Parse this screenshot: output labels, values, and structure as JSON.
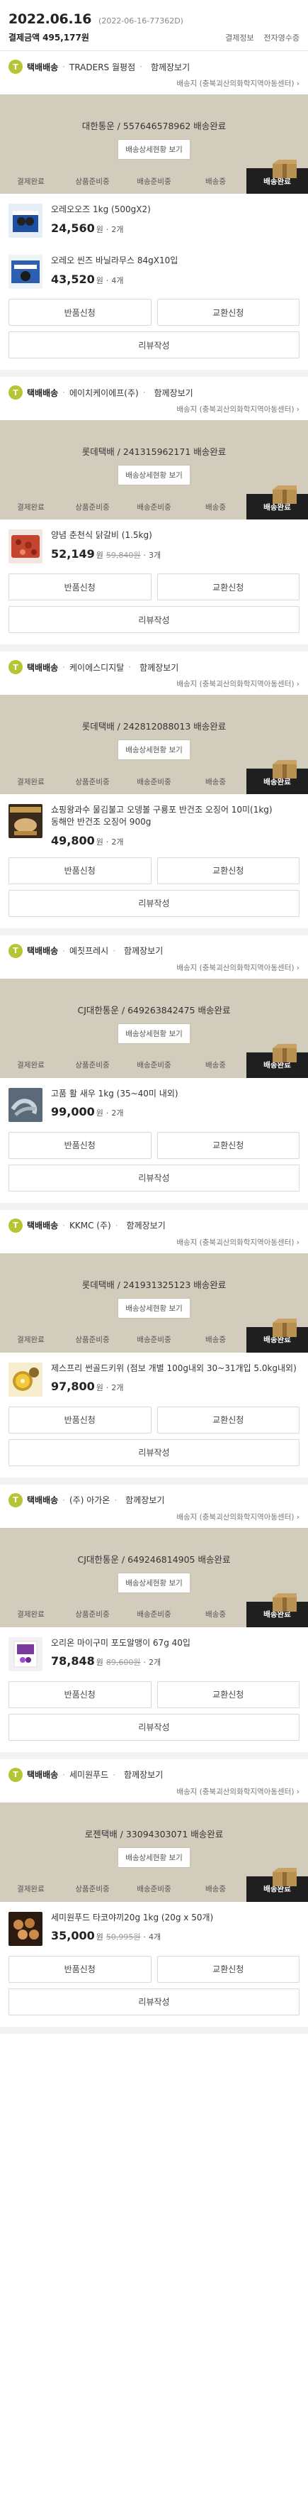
{
  "order": {
    "date": "2022.06.16",
    "number": "(2022-06-16-77362D)",
    "amount_label": "결제금액",
    "amount": "495,177원",
    "link_receipt": "결제정보",
    "link_doc": "전자영수증"
  },
  "labels": {
    "track": "배송상세현황 보기",
    "steps": [
      "결제완료",
      "상품준비중",
      "배송준비중",
      "배송중",
      "배송완료"
    ],
    "return": "반품신청",
    "exchange": "교환신청",
    "review": "리뷰작성",
    "unit": "원",
    "bundle": "함께장보기",
    "addr_prefix": "배송지"
  },
  "packages": [
    {
      "type": "택배배송",
      "seller": "TRADERS 월평점",
      "address": "(충북괴산의화학지역아동센터)",
      "carrier_status": "대한통운 / 557646578962 배송완료",
      "items": [
        {
          "name": "오레오오즈 1kg (500gX2)",
          "price": "24,560",
          "orig": "",
          "qty": "2개",
          "thumb": "oreo"
        },
        {
          "name": "오레오 씬즈 바닐라무스 84gX10입",
          "price": "43,520",
          "orig": "",
          "qty": "4개",
          "thumb": "oreo2"
        }
      ]
    },
    {
      "type": "택배배송",
      "seller": "에이치케이에프(주)",
      "address": "(충북괴산의화학지역아동센터)",
      "carrier_status": "롯데택배 / 241315962171 배송완료",
      "items": [
        {
          "name": "양념 춘천식 닭갈비 (1.5kg)",
          "price": "52,149",
          "orig": "59,840원",
          "qty": "3개",
          "thumb": "chicken"
        }
      ]
    },
    {
      "type": "택배배송",
      "seller": "케이에스디지탈",
      "address": "(충북괴산의화학지역아동센터)",
      "carrier_status": "롯데택배 / 242812088013 배송완료",
      "items": [
        {
          "name": "쇼핑왕과수 물김불고 오뎅볼 구룡포 반건조 오징어 10미(1kg)\n동해안 반건조 오징어 900g",
          "price": "49,800",
          "orig": "",
          "qty": "2개",
          "thumb": "squid"
        }
      ]
    },
    {
      "type": "택배배송",
      "seller": "예칫프레시",
      "address": "(충북괴산의화학지역아동센터)",
      "carrier_status": "CJ대한통운 / 649263842475 배송완료",
      "items": [
        {
          "name": "고품 활 새우 1kg (35~40미 내외)",
          "price": "99,000",
          "orig": "",
          "qty": "2개",
          "thumb": "shrimp"
        }
      ]
    },
    {
      "type": "택배배송",
      "seller": "KKMC (주)",
      "address": "(충북괴산의화학지역아동센터)",
      "carrier_status": "롯데택배 / 241931325123 배송완료",
      "items": [
        {
          "name": "제스프리 썬골드키위 (점보 개별 100g내외 30~31개입 5.0kg내외)",
          "price": "97,800",
          "orig": "",
          "qty": "2개",
          "thumb": "kiwi"
        }
      ]
    },
    {
      "type": "택배배송",
      "seller": "(주) 아가온",
      "address": "(충북괴산의화학지역아동센터)",
      "carrier_status": "CJ대한통운 / 649246814905 배송완료",
      "items": [
        {
          "name": "오리온 마이구미 포도알맹이 67g 40입",
          "price": "78,848",
          "orig": "89,600원",
          "qty": "2개",
          "thumb": "gummy"
        }
      ]
    },
    {
      "type": "택배배송",
      "seller": "세미원푸드",
      "address": "(충북괴산의화학지역아동센터)",
      "carrier_status": "로젠택배 / 33094303071 배송완료",
      "items": [
        {
          "name": "세미원푸드 타코야끼20g 1kg (20g x 50개)",
          "price": "35,000",
          "orig": "50,995원",
          "qty": "4개",
          "thumb": "takoyaki"
        }
      ]
    }
  ]
}
